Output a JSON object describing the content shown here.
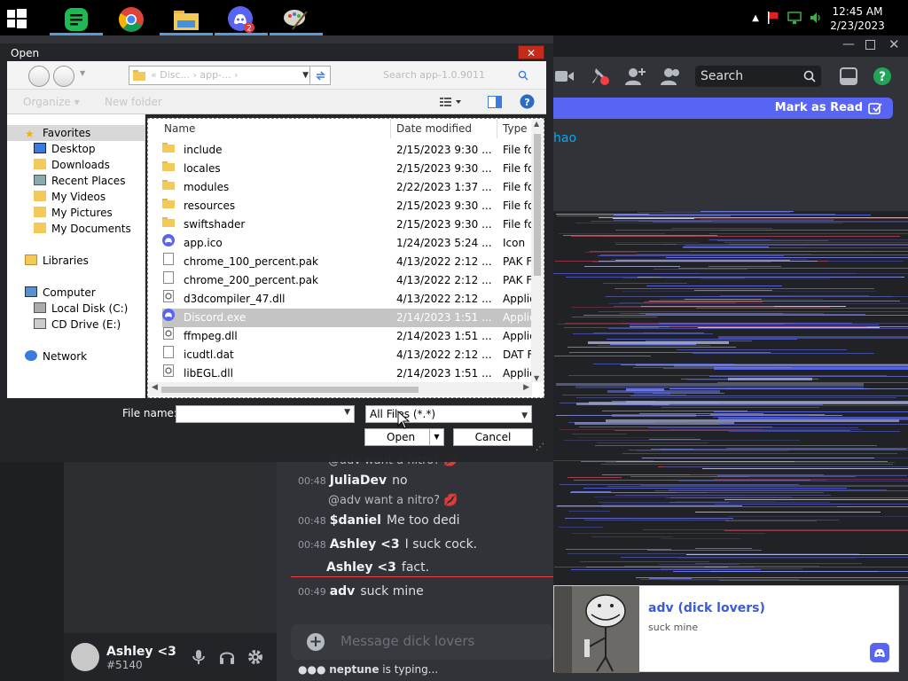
{
  "taskbar": {
    "apps": [
      {
        "name": "spotify",
        "badge": ""
      },
      {
        "name": "chrome",
        "badge": ""
      },
      {
        "name": "file-explorer",
        "badge": ""
      },
      {
        "name": "discord",
        "badge": "2"
      },
      {
        "name": "paint",
        "badge": ""
      }
    ],
    "clock": {
      "time": "12:45 AM",
      "date": "2/23/2023"
    },
    "accent": "#5a9bd5"
  },
  "discord": {
    "search_placeholder": "Search",
    "mark_as_read": "Mark as Read",
    "mention_text": "hao",
    "accent": "#5865f2",
    "user": {
      "name": "Ashley <3",
      "tag": "#5140"
    },
    "messages": [
      {
        "reply": "@adv want a nitro? 💋"
      },
      {
        "time": "00:48",
        "author": "JuliaDev",
        "text": "no"
      },
      {
        "reply": "@adv want a nitro? 💋"
      },
      {
        "time": "00:48",
        "author": "$daniel",
        "text": "Me too dedi"
      },
      {
        "time": "00:48",
        "author": "Ashley <3",
        "text": "I suck cock."
      },
      {
        "time": "",
        "author": "Ashley <3",
        "text": "fact."
      },
      {
        "time": "00:49",
        "author": "adv",
        "text": "suck mine"
      }
    ],
    "input_placeholder": "Message dick lovers",
    "typing": {
      "who": "neptune",
      "text": " is typing..."
    }
  },
  "notification": {
    "title": "adv (dick lovers)",
    "body": "suck mine"
  },
  "dialog": {
    "title": "Open",
    "close_label": "✕",
    "address": "« Disc...  ›  app-...  ›",
    "search_placeholder": "Search app-1.0.9011",
    "organize_label": "Organize ▾",
    "new_folder_label": "New folder",
    "tree": {
      "favorites": "Favorites",
      "desktop": "Desktop",
      "downloads": "Downloads",
      "recent": "Recent Places",
      "videos": "My Videos",
      "pictures": "My Pictures",
      "documents": "My Documents",
      "libraries": "Libraries",
      "computer": "Computer",
      "local_disk": "Local Disk (C:)",
      "cd_drive": "CD Drive (E:)",
      "network": "Network"
    },
    "columns": {
      "name": "Name",
      "date": "Date modified",
      "type": "Type"
    },
    "files": [
      {
        "icon": "folder",
        "name": "include",
        "date": "2/15/2023 9:30 ...",
        "type": "File fo"
      },
      {
        "icon": "folder",
        "name": "locales",
        "date": "2/15/2023 9:30 ...",
        "type": "File fo"
      },
      {
        "icon": "folder",
        "name": "modules",
        "date": "2/22/2023 1:37 ...",
        "type": "File fo"
      },
      {
        "icon": "folder",
        "name": "resources",
        "date": "2/15/2023 9:30 ...",
        "type": "File fo"
      },
      {
        "icon": "folder",
        "name": "swiftshader",
        "date": "2/15/2023 9:30 ...",
        "type": "File fo"
      },
      {
        "icon": "discord",
        "name": "app.ico",
        "date": "1/24/2023 5:24 ...",
        "type": "Icon"
      },
      {
        "icon": "file",
        "name": "chrome_100_percent.pak",
        "date": "4/13/2022 2:12 ...",
        "type": "PAK F"
      },
      {
        "icon": "file",
        "name": "chrome_200_percent.pak",
        "date": "4/13/2022 2:12 ...",
        "type": "PAK F"
      },
      {
        "icon": "dll",
        "name": "d3dcompiler_47.dll",
        "date": "4/13/2022 2:12 ...",
        "type": "Applic"
      },
      {
        "icon": "discord",
        "name": "Discord.exe",
        "date": "2/14/2023 1:51 ...",
        "type": "Applic",
        "selected": true
      },
      {
        "icon": "dll",
        "name": "ffmpeg.dll",
        "date": "2/14/2023 1:51 ...",
        "type": "Applic"
      },
      {
        "icon": "file",
        "name": "icudtl.dat",
        "date": "4/13/2022 2:12 ...",
        "type": "DAT F"
      },
      {
        "icon": "dll",
        "name": "libEGL.dll",
        "date": "2/14/2023 1:51 ...",
        "type": "Applic"
      }
    ],
    "file_name_label": "File name:",
    "file_name_value": "",
    "file_type": "All Files (*.*)",
    "open_label": "Open",
    "cancel_label": "Cancel"
  }
}
